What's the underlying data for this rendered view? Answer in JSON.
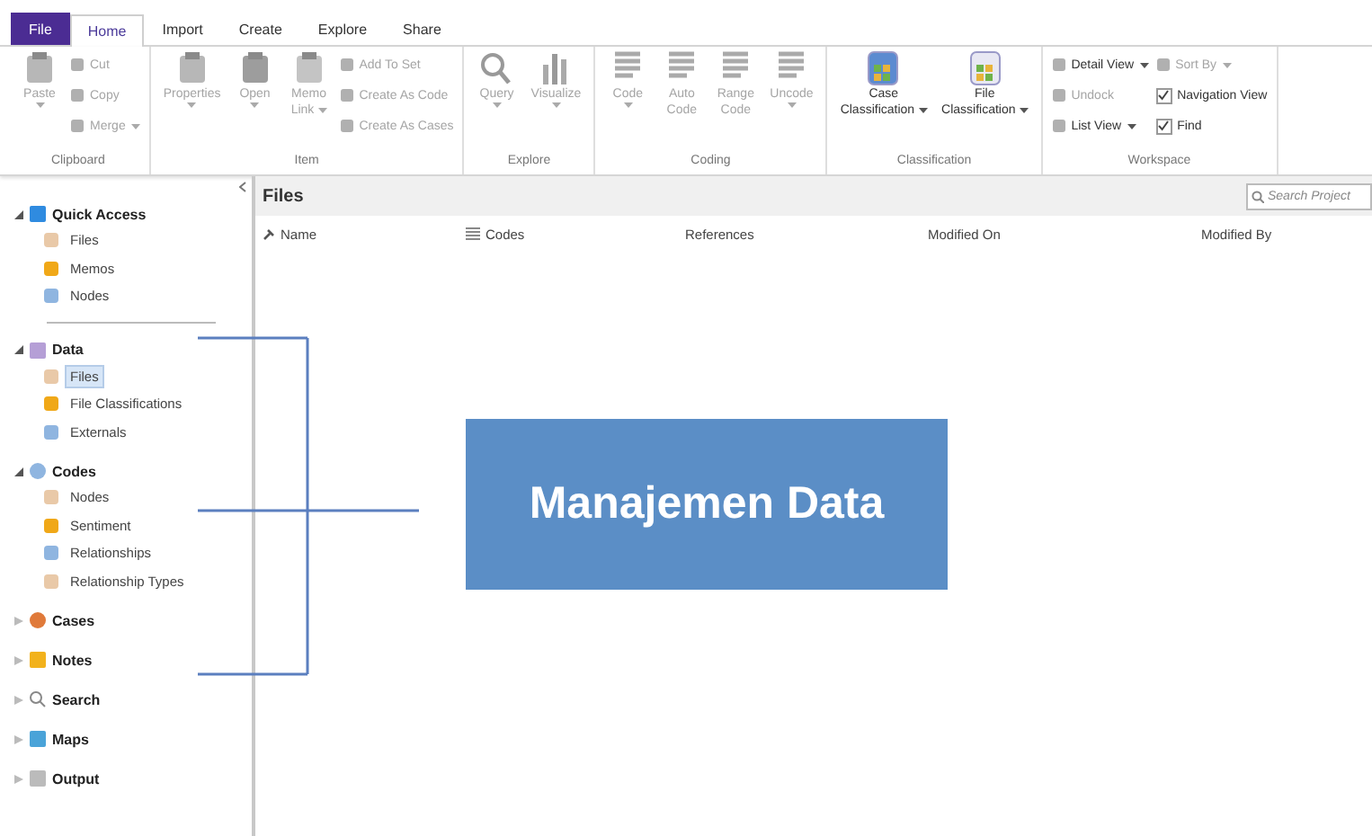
{
  "tabs": [
    {
      "label": "File",
      "kind": "file",
      "selected": false
    },
    {
      "label": "Home",
      "kind": "tab",
      "selected": true
    },
    {
      "label": "Import",
      "kind": "tab",
      "selected": false
    },
    {
      "label": "Create",
      "kind": "tab",
      "selected": false
    },
    {
      "label": "Explore",
      "kind": "tab",
      "selected": false
    },
    {
      "label": "Share",
      "kind": "tab",
      "selected": false
    }
  ],
  "ribbon": [
    {
      "label": "Clipboard",
      "large": [
        {
          "lines": [
            "Paste"
          ],
          "dropdown": true,
          "disabled": true
        }
      ],
      "small": [
        [
          {
            "label": "Cut",
            "kind": "command",
            "disabled": true
          },
          {
            "label": "Copy",
            "kind": "command",
            "disabled": true
          },
          {
            "label": "Merge",
            "kind": "command",
            "dropdown": true,
            "disabled": true
          }
        ]
      ]
    },
    {
      "label": "Item",
      "large": [
        {
          "lines": [
            "Properties"
          ],
          "dropdown": true,
          "disabled": true
        },
        {
          "lines": [
            "Open"
          ],
          "dropdown": true,
          "disabled": true
        },
        {
          "lines": [
            "Memo",
            "Link"
          ],
          "dropdown": true,
          "disabled": true
        }
      ],
      "small": [
        [
          {
            "label": "Add To Set",
            "kind": "command",
            "disabled": true
          },
          {
            "label": "Create As Code",
            "kind": "command",
            "disabled": true
          },
          {
            "label": "Create As Cases",
            "kind": "command",
            "disabled": true
          }
        ]
      ]
    },
    {
      "label": "Explore",
      "large": [
        {
          "lines": [
            "Query"
          ],
          "dropdown": true,
          "disabled": true
        },
        {
          "lines": [
            "Visualize"
          ],
          "dropdown": true,
          "disabled": true
        }
      ]
    },
    {
      "label": "Coding",
      "large": [
        {
          "lines": [
            "Code"
          ],
          "dropdown": true,
          "disabled": true
        },
        {
          "lines": [
            "Auto",
            "Code"
          ],
          "disabled": true
        },
        {
          "lines": [
            "Range",
            "Code"
          ],
          "disabled": true
        },
        {
          "lines": [
            "Uncode"
          ],
          "dropdown": true,
          "disabled": true
        }
      ]
    },
    {
      "label": "Classification",
      "large": [
        {
          "lines": [
            "Case",
            "Classification"
          ],
          "dropdown": true,
          "disabled": false
        },
        {
          "lines": [
            "File",
            "Classification"
          ],
          "dropdown": true,
          "disabled": false
        }
      ]
    },
    {
      "label": "Workspace",
      "small": [
        [
          {
            "label": "Detail View",
            "kind": "command",
            "dropdown": true,
            "disabled": false
          },
          {
            "label": "Undock",
            "kind": "command",
            "disabled": true
          },
          {
            "label": "List View",
            "kind": "command",
            "dropdown": true,
            "disabled": false
          }
        ],
        [
          {
            "label": "Sort By",
            "kind": "command",
            "dropdown": true,
            "disabled": true
          },
          {
            "label": "Navigation View",
            "kind": "checkbox",
            "checked": true
          },
          {
            "label": "Find",
            "kind": "checkbox",
            "checked": true
          }
        ]
      ]
    }
  ],
  "sidebar": [
    {
      "label": "Quick Access",
      "expanded": true,
      "separator": true,
      "children": [
        {
          "label": "Files",
          "selected": false
        },
        {
          "label": "Memos",
          "selected": false
        },
        {
          "label": "Nodes",
          "selected": false
        }
      ]
    },
    {
      "label": "Data",
      "expanded": true,
      "children": [
        {
          "label": "Files",
          "selected": true
        },
        {
          "label": "File Classifications",
          "selected": false
        },
        {
          "label": "Externals",
          "selected": false
        }
      ]
    },
    {
      "label": "Codes",
      "expanded": true,
      "children": [
        {
          "label": "Nodes",
          "selected": false
        },
        {
          "label": "Sentiment",
          "selected": false
        },
        {
          "label": "Relationships",
          "selected": false
        },
        {
          "label": "Relationship Types",
          "selected": false
        }
      ]
    },
    {
      "label": "Cases",
      "expanded": false
    },
    {
      "label": "Notes",
      "expanded": false
    },
    {
      "label": "Search",
      "expanded": false
    },
    {
      "label": "Maps",
      "expanded": false
    },
    {
      "label": "Output",
      "expanded": false
    }
  ],
  "content": {
    "title": "Files",
    "search": {
      "placeholder": "Search Project"
    },
    "columns": [
      "Name",
      "Codes",
      "References",
      "Modified On",
      "Modified By"
    ]
  },
  "callout": {
    "label": "Manajemen Data"
  }
}
